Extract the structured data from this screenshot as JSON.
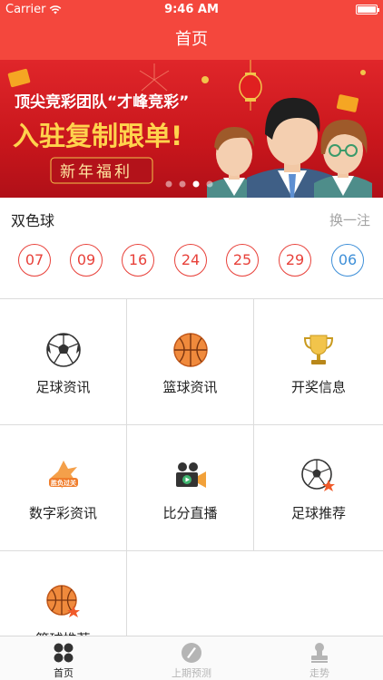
{
  "status_bar": {
    "carrier": "Carrier",
    "time": "9:46 AM"
  },
  "nav": {
    "title": "首页"
  },
  "banner": {
    "headline_1": "顶尖竞彩团队“才峰竞彩”",
    "headline_2": "入驻复制跟单!",
    "tag": "新年福利",
    "active_dot": 3,
    "dot_count": 4
  },
  "lottery": {
    "title": "双色球",
    "refresh_label": "换一注",
    "red_balls": [
      "07",
      "09",
      "16",
      "24",
      "25",
      "29"
    ],
    "blue_ball": "06"
  },
  "menu": [
    {
      "label": "足球资讯",
      "icon": "soccer-ball-icon"
    },
    {
      "label": "篮球资讯",
      "icon": "basketball-icon"
    },
    {
      "label": "开奖信息",
      "icon": "trophy-icon"
    },
    {
      "label": "数字彩资讯",
      "icon": "lucky-logo-icon"
    },
    {
      "label": "比分直播",
      "icon": "video-camera-icon"
    },
    {
      "label": "足球推荐",
      "icon": "soccer-star-icon"
    },
    {
      "label": "篮球推荐",
      "icon": "basketball-star-icon"
    }
  ],
  "tabs": [
    {
      "label": "首页",
      "icon": "grid-icon",
      "active": true
    },
    {
      "label": "上期预测",
      "icon": "compass-icon",
      "active": false
    },
    {
      "label": "走势",
      "icon": "stamp-icon",
      "active": false
    }
  ],
  "colors": {
    "brand": "#f4473d",
    "ball_red": "#e8413a",
    "ball_blue": "#3e8fd8",
    "gold": "#f2c44b"
  }
}
